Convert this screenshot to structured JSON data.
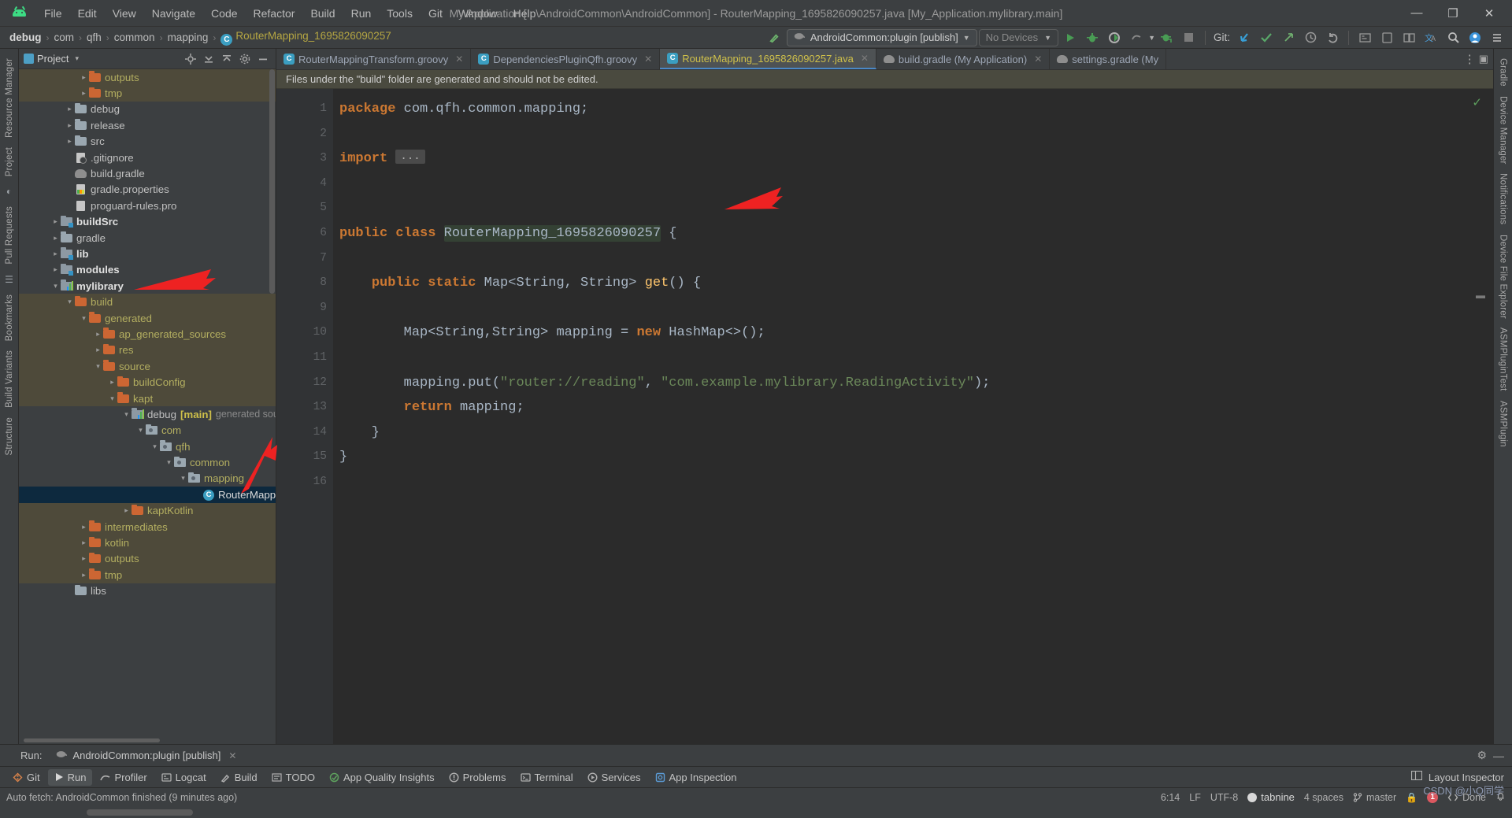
{
  "window": {
    "title": "My Application [...\\AndroidCommon\\AndroidCommon] - RouterMapping_1695826090257.java [My_Application.mylibrary.main]",
    "minimize": "—",
    "maximize": "❐",
    "close": "✕",
    "logo_name": "android-studio-logo"
  },
  "menu": {
    "items": [
      {
        "label": "File"
      },
      {
        "label": "Edit"
      },
      {
        "label": "View"
      },
      {
        "label": "Navigate"
      },
      {
        "label": "Code"
      },
      {
        "label": "Refactor"
      },
      {
        "label": "Build"
      },
      {
        "label": "Run"
      },
      {
        "label": "Tools"
      },
      {
        "label": "Git"
      },
      {
        "label": "Window"
      },
      {
        "label": "Help"
      }
    ]
  },
  "navbar": {
    "breadcrumbs": [
      {
        "label": "debug",
        "bold": true
      },
      {
        "label": "com",
        "bold": false
      },
      {
        "label": "qfh",
        "bold": false
      },
      {
        "label": "common",
        "bold": false
      },
      {
        "label": "mapping",
        "bold": false
      }
    ],
    "separator": "›",
    "class_badge": "C",
    "class_name": "RouterMapping_1695826090257",
    "run_config": "AndroidCommon:plugin [publish]",
    "devices": "No Devices",
    "git_label": "Git:",
    "icons": [
      "hammer-build-icon",
      "run-icon",
      "debug-icon",
      "run-coverage-icon",
      "profile-icon",
      "attach-debugger-icon",
      "stop-icon",
      "git-update-icon",
      "git-commit-icon",
      "git-push-icon",
      "history-icon",
      "undo-icon",
      "search-everywhere-icon",
      "settings-icon",
      "account-icon"
    ]
  },
  "project_panel": {
    "title": "Project",
    "dropdown_caret": "▾",
    "actions": [
      "locate-icon",
      "collapse-all-icon",
      "expand-all-icon",
      "settings-icon",
      "hide-icon"
    ],
    "tree": [
      {
        "depth": 4,
        "arrow": "›",
        "icon": "folder-orange",
        "label": "outputs",
        "color": "yellow",
        "state": "highlight"
      },
      {
        "depth": 4,
        "arrow": "›",
        "icon": "folder-orange",
        "label": "tmp",
        "color": "yellow",
        "state": "highlight"
      },
      {
        "depth": 3,
        "arrow": "›",
        "icon": "folder-gray",
        "label": "debug",
        "color": "gray",
        "state": "none"
      },
      {
        "depth": 3,
        "arrow": "›",
        "icon": "folder-gray",
        "label": "release",
        "color": "gray",
        "state": "none"
      },
      {
        "depth": 3,
        "arrow": "›",
        "icon": "folder-gray",
        "label": "src",
        "color": "gray",
        "state": "none"
      },
      {
        "depth": 3,
        "arrow": "",
        "icon": "gitignore-file",
        "label": ".gitignore",
        "color": "gray",
        "state": "none"
      },
      {
        "depth": 3,
        "arrow": "",
        "icon": "gradle-file",
        "label": "build.gradle",
        "color": "gray",
        "state": "none"
      },
      {
        "depth": 3,
        "arrow": "",
        "icon": "properties-file",
        "label": "gradle.properties",
        "color": "gray",
        "state": "none"
      },
      {
        "depth": 3,
        "arrow": "",
        "icon": "text-file",
        "label": "proguard-rules.pro",
        "color": "gray",
        "state": "none"
      },
      {
        "depth": 2,
        "arrow": "›",
        "icon": "module-folder",
        "label": "buildSrc",
        "color": "bold",
        "state": "none"
      },
      {
        "depth": 2,
        "arrow": "›",
        "icon": "folder-gray",
        "label": "gradle",
        "color": "gray",
        "state": "none"
      },
      {
        "depth": 2,
        "arrow": "›",
        "icon": "module-folder",
        "label": "lib",
        "color": "bold",
        "state": "none"
      },
      {
        "depth": 2,
        "arrow": "›",
        "icon": "module-folder",
        "label": "modules",
        "color": "bold",
        "state": "none"
      },
      {
        "depth": 2,
        "arrow": "⌄",
        "icon": "android-module",
        "label": "mylibrary",
        "color": "bold",
        "state": "none"
      },
      {
        "depth": 3,
        "arrow": "⌄",
        "icon": "folder-orange",
        "label": "build",
        "color": "yellow",
        "state": "highlight"
      },
      {
        "depth": 4,
        "arrow": "⌄",
        "icon": "folder-orange",
        "label": "generated",
        "color": "yellow",
        "state": "highlight"
      },
      {
        "depth": 5,
        "arrow": "›",
        "icon": "folder-orange",
        "label": "ap_generated_sources",
        "color": "yellow",
        "state": "highlight"
      },
      {
        "depth": 5,
        "arrow": "›",
        "icon": "folder-orange",
        "label": "res",
        "color": "yellow",
        "state": "highlight"
      },
      {
        "depth": 5,
        "arrow": "⌄",
        "icon": "folder-orange",
        "label": "source",
        "color": "yellow",
        "state": "highlight"
      },
      {
        "depth": 6,
        "arrow": "›",
        "icon": "folder-orange",
        "label": "buildConfig",
        "color": "yellow",
        "state": "highlight"
      },
      {
        "depth": 6,
        "arrow": "⌄",
        "icon": "folder-orange",
        "label": "kapt",
        "color": "yellow",
        "state": "highlight"
      },
      {
        "depth": 7,
        "arrow": "⌄",
        "icon": "android-module",
        "label": "debug",
        "color": "gray",
        "state": "none",
        "suffix_bold": "[main]",
        "suffix_dim": "generated sou"
      },
      {
        "depth": 8,
        "arrow": "⌄",
        "icon": "package-folder",
        "label": "com",
        "color": "yellow",
        "state": "none"
      },
      {
        "depth": 9,
        "arrow": "⌄",
        "icon": "package-folder",
        "label": "qfh",
        "color": "yellow",
        "state": "none"
      },
      {
        "depth": 10,
        "arrow": "⌄",
        "icon": "package-folder",
        "label": "common",
        "color": "yellow",
        "state": "none"
      },
      {
        "depth": 11,
        "arrow": "⌄",
        "icon": "package-folder",
        "label": "mapping",
        "color": "yellow",
        "state": "none"
      },
      {
        "depth": 12,
        "arrow": "",
        "icon": "java-class",
        "label": "RouterMappin",
        "color": "white",
        "state": "selected"
      },
      {
        "depth": 7,
        "arrow": "›",
        "icon": "folder-orange",
        "label": "kaptKotlin",
        "color": "yellow",
        "state": "highlight"
      },
      {
        "depth": 4,
        "arrow": "›",
        "icon": "folder-orange",
        "label": "intermediates",
        "color": "yellow",
        "state": "highlight"
      },
      {
        "depth": 4,
        "arrow": "›",
        "icon": "folder-orange",
        "label": "kotlin",
        "color": "yellow",
        "state": "highlight"
      },
      {
        "depth": 4,
        "arrow": "›",
        "icon": "folder-orange",
        "label": "outputs",
        "color": "yellow",
        "state": "highlight"
      },
      {
        "depth": 4,
        "arrow": "›",
        "icon": "folder-orange",
        "label": "tmp",
        "color": "yellow",
        "state": "highlight"
      },
      {
        "depth": 3,
        "arrow": "",
        "icon": "folder-gray",
        "label": "libs",
        "color": "gray",
        "state": "none"
      }
    ]
  },
  "left_strip": {
    "tabs": [
      {
        "label": "Resource Manager"
      },
      {
        "label": "Project"
      },
      {
        "label": "Pull Requests"
      },
      {
        "label": "Bookmarks"
      },
      {
        "label": "Build Variants"
      },
      {
        "label": "Structure"
      }
    ],
    "icons": [
      "android-icon",
      "pin-icon"
    ]
  },
  "right_strip": {
    "tabs": [
      {
        "label": "Gradle"
      },
      {
        "label": "Device Manager"
      },
      {
        "label": "Notifications"
      },
      {
        "label": "Device File Explorer"
      },
      {
        "label": "ASMPluginTest"
      },
      {
        "label": "ASMPlugin"
      }
    ]
  },
  "editor": {
    "tabs": [
      {
        "label": "RouterMappingTransform.groovy",
        "icon": "groovy-class-icon",
        "active": false,
        "closable": true
      },
      {
        "label": "DependenciesPluginQfh.groovy",
        "icon": "groovy-class-icon",
        "active": false,
        "closable": true
      },
      {
        "label": "RouterMapping_1695826090257.java",
        "icon": "java-class-icon",
        "active": true,
        "closable": true
      },
      {
        "label": "build.gradle (My Application)",
        "icon": "gradle-icon",
        "active": false,
        "closable": true
      },
      {
        "label": "settings.gradle (My",
        "icon": "gradle-icon",
        "active": false,
        "closable": false
      }
    ],
    "more_icon": "⋮",
    "notice": "Files under the \"build\" folder are generated and should not be edited.",
    "inspection_status": "✓",
    "gutter_marks": {
      "line8": "@"
    },
    "line_numbers": [
      "1",
      "2",
      "3",
      "4",
      "5",
      "6",
      "7",
      "8",
      "9",
      "10",
      "11",
      "12",
      "13",
      "14",
      "15",
      "16"
    ],
    "lines": [
      {
        "n": 1,
        "tokens": [
          {
            "t": "kw",
            "v": "package"
          },
          {
            "t": "pl",
            "v": " com.qfh.common.mapping;"
          }
        ]
      },
      {
        "n": 2,
        "tokens": []
      },
      {
        "n": 3,
        "tokens": [
          {
            "t": "kw",
            "v": "import"
          },
          {
            "t": "pl",
            "v": " "
          },
          {
            "t": "dots",
            "v": "..."
          }
        ]
      },
      {
        "n": 4,
        "tokens": []
      },
      {
        "n": 5,
        "tokens": []
      },
      {
        "n": 6,
        "tokens": [
          {
            "t": "kw",
            "v": "public class"
          },
          {
            "t": "pl",
            "v": " "
          },
          {
            "t": "hl",
            "v": "RouterMapping_1695826090257"
          },
          {
            "t": "pl",
            "v": " {"
          }
        ]
      },
      {
        "n": 7,
        "tokens": []
      },
      {
        "n": 8,
        "tokens": [
          {
            "t": "pl",
            "v": "    "
          },
          {
            "t": "kw",
            "v": "public static"
          },
          {
            "t": "pl",
            "v": " Map<String, String> "
          },
          {
            "t": "fn",
            "v": "get"
          },
          {
            "t": "pl",
            "v": "() {"
          }
        ]
      },
      {
        "n": 9,
        "tokens": []
      },
      {
        "n": 10,
        "tokens": [
          {
            "t": "pl",
            "v": "        Map<String,String> mapping = "
          },
          {
            "t": "kw",
            "v": "new"
          },
          {
            "t": "pl",
            "v": " "
          },
          {
            "t": "type",
            "v": "HashMap"
          },
          {
            "t": "pl",
            "v": "<>();"
          }
        ]
      },
      {
        "n": 11,
        "tokens": []
      },
      {
        "n": 12,
        "tokens": [
          {
            "t": "pl",
            "v": "        mapping.put("
          },
          {
            "t": "str",
            "v": "\"router://reading\""
          },
          {
            "t": "pl",
            "v": ", "
          },
          {
            "t": "str",
            "v": "\"com.example.mylibrary.ReadingActivity\""
          },
          {
            "t": "pl",
            "v": ");"
          }
        ]
      },
      {
        "n": 13,
        "tokens": [
          {
            "t": "pl",
            "v": "        "
          },
          {
            "t": "kw",
            "v": "return"
          },
          {
            "t": "pl",
            "v": " mapping;"
          }
        ]
      },
      {
        "n": 14,
        "tokens": [
          {
            "t": "pl",
            "v": "    }"
          }
        ]
      },
      {
        "n": 15,
        "tokens": [
          {
            "t": "pl",
            "v": "}"
          }
        ]
      },
      {
        "n": 16,
        "tokens": []
      }
    ]
  },
  "run_panel": {
    "label": "Run:",
    "tab_label": "AndroidCommon:plugin [publish]",
    "tab_icon": "gradle-icon",
    "close": "✕",
    "settings_icon": "⚙",
    "minimize_icon": "—"
  },
  "tool_windows": {
    "items": [
      {
        "label": "Git",
        "icon": "git-icon"
      },
      {
        "label": "Run",
        "icon": "run-icon",
        "active": true
      },
      {
        "label": "Profiler",
        "icon": "profiler-icon"
      },
      {
        "label": "Logcat",
        "icon": "logcat-icon"
      },
      {
        "label": "Build",
        "icon": "build-icon"
      },
      {
        "label": "TODO",
        "icon": "todo-icon"
      },
      {
        "label": "App Quality Insights",
        "icon": "insights-icon"
      },
      {
        "label": "Problems",
        "icon": "problems-icon"
      },
      {
        "label": "Terminal",
        "icon": "terminal-icon"
      },
      {
        "label": "Services",
        "icon": "services-icon"
      },
      {
        "label": "App Inspection",
        "icon": "inspection-icon"
      }
    ],
    "right_label": "Layout Inspector",
    "right_icon": "layout-inspector-icon"
  },
  "status_bar": {
    "message": "Auto fetch: AndroidCommon finished (9 minutes ago)",
    "caret_position": "6:14",
    "line_separator": "LF",
    "encoding": "UTF-8",
    "tabnine": "tabnine",
    "indent": "4 spaces",
    "branch": "master",
    "branch_icon": "git-branch-icon",
    "lock_icon": "lock-icon",
    "error_count": "1",
    "inspection": "Done",
    "watermark": "CSDN @小Q同学"
  },
  "colors": {
    "accent_blue": "#3b9ec1",
    "folder_orange": "#cc6633",
    "highlight_row": "#4e4a3a",
    "selected_row": "#0d293e",
    "keyword": "#cc7832",
    "string": "#6a8759",
    "annotation_red": "#ee2222"
  }
}
